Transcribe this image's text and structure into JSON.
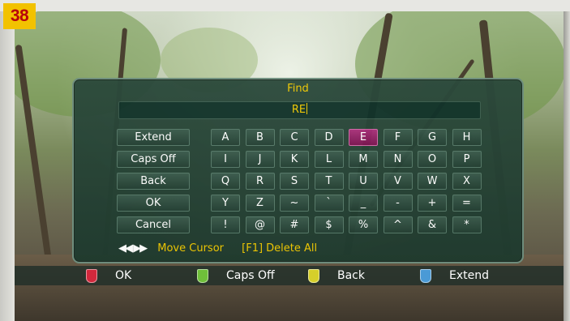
{
  "channel_number": "38",
  "dialog": {
    "title": "Find",
    "input_value": "RE"
  },
  "function_buttons": [
    "Extend",
    "Caps Off",
    "Back",
    "OK",
    "Cancel"
  ],
  "keyboard": {
    "rows": [
      [
        "A",
        "B",
        "C",
        "D",
        "E",
        "F",
        "G",
        "H"
      ],
      [
        "I",
        "J",
        "K",
        "L",
        "M",
        "N",
        "O",
        "P"
      ],
      [
        "Q",
        "R",
        "S",
        "T",
        "U",
        "V",
        "W",
        "X"
      ],
      [
        "Y",
        "Z",
        "~",
        "`",
        "_",
        "-",
        "+",
        "="
      ],
      [
        "!",
        "@",
        "#",
        "$",
        "%",
        "^",
        "&",
        "*"
      ]
    ],
    "selected_key": "E"
  },
  "help": {
    "arrows": "◀◀ ▶▶",
    "move_cursor": "Move Cursor",
    "delete_all": "[F1] Delete All"
  },
  "color_keys": [
    {
      "label": "OK",
      "color": "#d2283c",
      "icon": "red-key-icon"
    },
    {
      "label": "Caps Off",
      "color": "#6fbf3a",
      "icon": "green-key-icon"
    },
    {
      "label": "Back",
      "color": "#d6cf2a",
      "icon": "yellow-key-icon"
    },
    {
      "label": "Extend",
      "color": "#4a9ad6",
      "icon": "blue-key-icon"
    }
  ],
  "colors": {
    "accent_text": "#f0c800",
    "dialog_bg": "#1f3a2e",
    "selected_key": "#a8307a",
    "badge_bg": "#f2c200",
    "badge_text": "#b8000a"
  }
}
